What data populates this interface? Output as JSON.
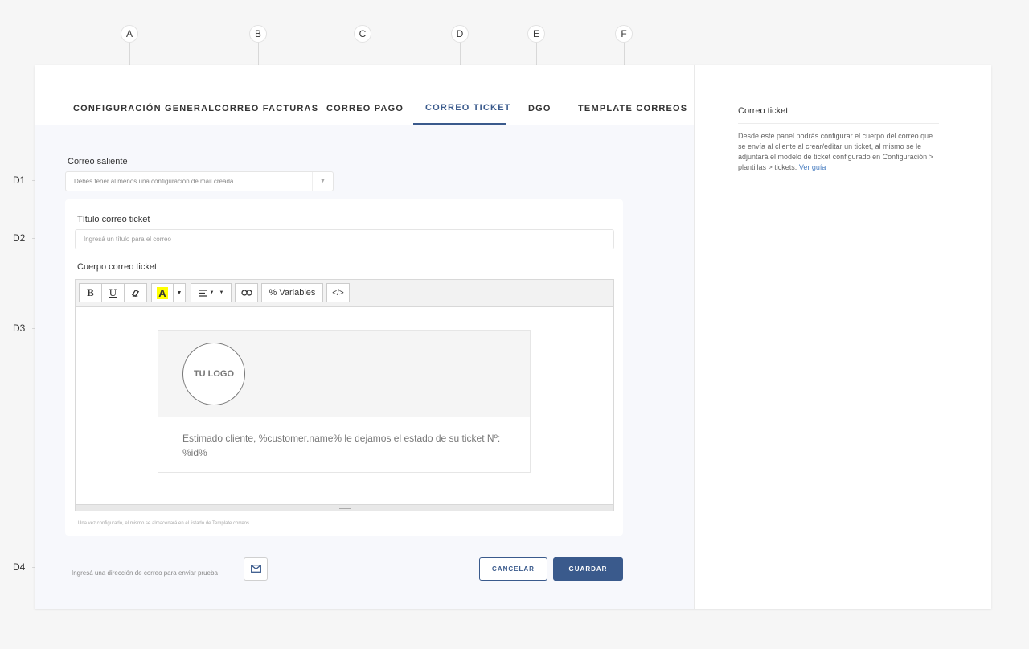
{
  "markers": {
    "top": [
      "A",
      "B",
      "C",
      "D",
      "E",
      "F"
    ],
    "side": [
      "D1",
      "D2",
      "D3",
      "D4"
    ]
  },
  "tabs": [
    {
      "label": "CONFIGURACIÓN GENERAL"
    },
    {
      "label": "CORREO FACTURAS"
    },
    {
      "label": "CORREO PAGO"
    },
    {
      "label": "CORREO TICKET",
      "active": true
    },
    {
      "label": "DGO"
    },
    {
      "label": "TEMPLATE CORREOS"
    }
  ],
  "form": {
    "outgoing_label": "Correo saliente",
    "outgoing_placeholder": "Debés tener al menos una configuración de mail creada",
    "title_label": "Título correo ticket",
    "title_placeholder": "Ingresá un título para el correo",
    "body_label": "Cuerpo correo ticket",
    "hint": "Una vez configurado, el mismo se almacenará en el listado de Template correos.",
    "test_placeholder": "Ingresá una dirección de correo para enviar prueba"
  },
  "toolbar": {
    "bold": "B",
    "underline": "U",
    "highlight": "A",
    "variables": "% Variables",
    "code": "</>"
  },
  "email_preview": {
    "logo_text": "TU LOGO",
    "body": "Estimado cliente, %customer.name% le dejamos el estado de su ticket Nº: %id%"
  },
  "actions": {
    "cancel": "CANCELAR",
    "save": "GUARDAR"
  },
  "help": {
    "title": "Correo ticket",
    "body": "Desde este panel podrás configurar el cuerpo del correo que se envía al cliente al crear/editar un ticket, al mismo se le adjuntará el modelo de ticket configurado en Configuración > plantillas > tickets.",
    "link": "Ver guía"
  },
  "colors": {
    "accent": "#3a5a8c",
    "link": "#4a7fc1"
  }
}
